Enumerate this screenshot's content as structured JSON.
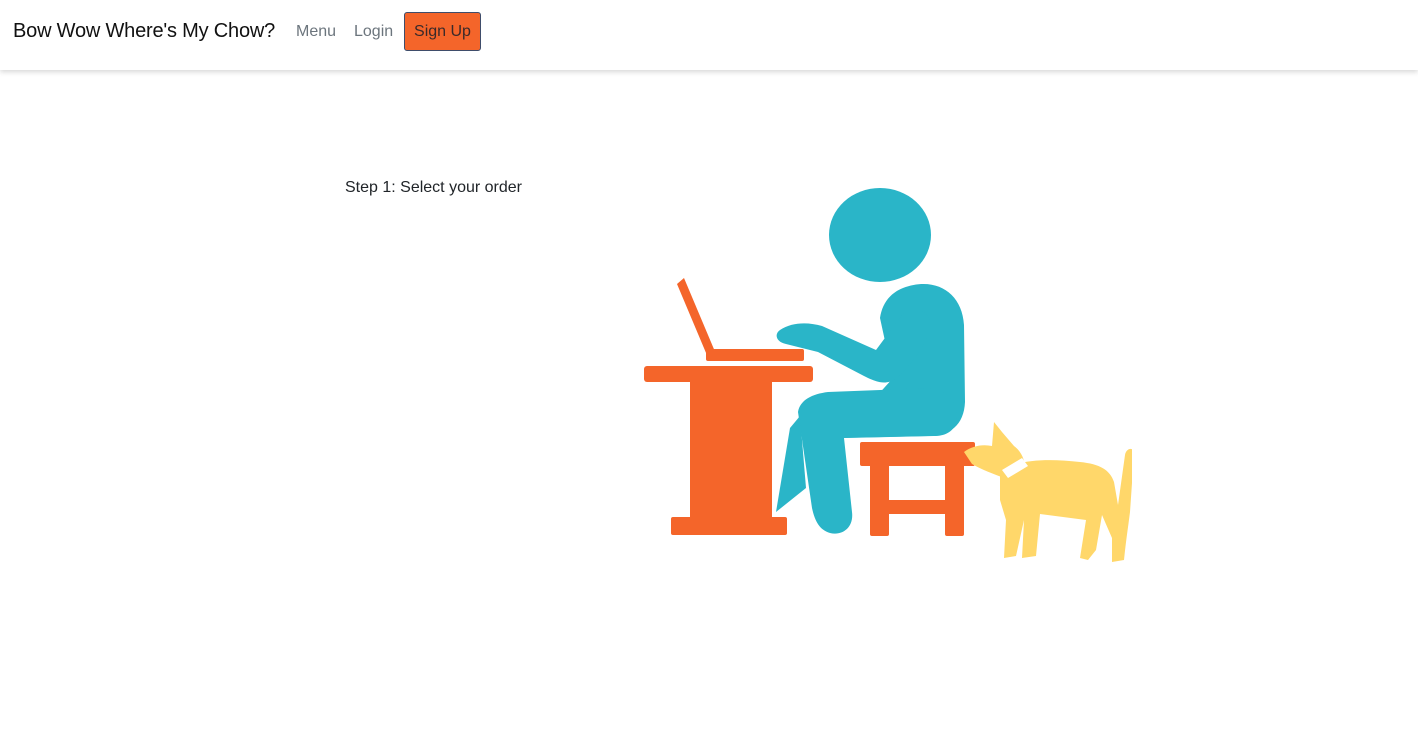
{
  "navbar": {
    "brand": "Bow Wow Where's My Chow?",
    "links": {
      "menu": "Menu",
      "login": "Login"
    },
    "signup_label": "Sign Up"
  },
  "main": {
    "step_text": "Step 1: Select your order"
  },
  "illustration": {
    "subject": "person-at-laptop-with-dog",
    "colors": {
      "desk": "#f4652a",
      "person": "#2ab5c8",
      "dog": "#ffd76a",
      "brand_button": "#f4652a"
    }
  }
}
